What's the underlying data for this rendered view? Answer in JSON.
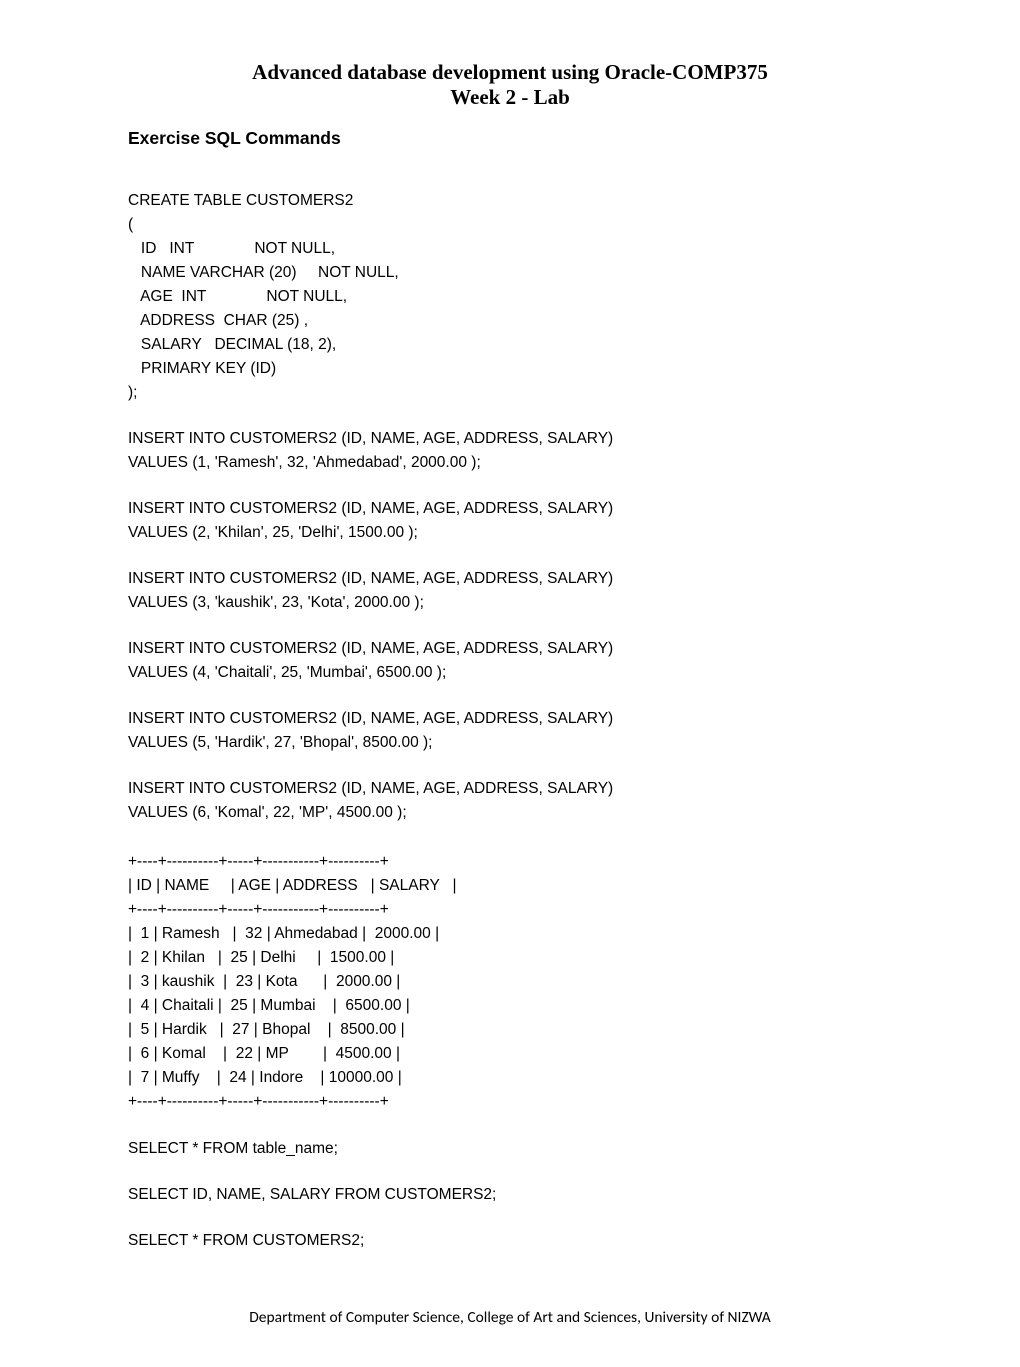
{
  "header": {
    "title": "Advanced database development using Oracle-COMP375",
    "subtitle": "Week 2 - Lab"
  },
  "section_title": "Exercise  SQL Commands",
  "create_table": "CREATE TABLE CUSTOMERS2\n(\n   ID   INT              NOT NULL,\n   NAME VARCHAR (20)     NOT NULL,\n   AGE  INT              NOT NULL,\n   ADDRESS  CHAR (25) ,\n   SALARY   DECIMAL (18, 2),       \n   PRIMARY KEY (ID)\n);",
  "inserts": [
    "INSERT INTO CUSTOMERS2 (ID, NAME, AGE, ADDRESS, SALARY)\nVALUES (1, 'Ramesh', 32, 'Ahmedabad', 2000.00 );",
    "INSERT INTO CUSTOMERS2 (ID, NAME, AGE, ADDRESS, SALARY)\nVALUES (2, 'Khilan', 25, 'Delhi', 1500.00 );",
    "INSERT INTO CUSTOMERS2 (ID, NAME, AGE, ADDRESS, SALARY)\nVALUES (3, 'kaushik', 23, 'Kota', 2000.00 );",
    "INSERT INTO CUSTOMERS2 (ID, NAME, AGE, ADDRESS, SALARY)\nVALUES (4, 'Chaitali', 25, 'Mumbai', 6500.00 );",
    "INSERT INTO CUSTOMERS2 (ID, NAME, AGE, ADDRESS, SALARY)\nVALUES (5, 'Hardik', 27, 'Bhopal', 8500.00 );",
    "INSERT INTO CUSTOMERS2 (ID, NAME, AGE, ADDRESS, SALARY)\nVALUES (6, 'Komal', 22, 'MP', 4500.00 );"
  ],
  "table_output": "+----+----------+-----+-----------+----------+\n| ID | NAME     | AGE | ADDRESS   | SALARY   |\n+----+----------+-----+-----------+----------+\n|  1 | Ramesh   |  32 | Ahmedabad |  2000.00 |\n|  2 | Khilan   |  25 | Delhi     |  1500.00 |\n|  3 | kaushik  |  23 | Kota      |  2000.00 |\n|  4 | Chaitali |  25 | Mumbai    |  6500.00 |\n|  5 | Hardik   |  27 | Bhopal    |  8500.00 |\n|  6 | Komal    |  22 | MP        |  4500.00 |\n|  7 | Muffy    |  24 | Indore    | 10000.00 |\n+----+----------+-----+-----------+----------+",
  "selects": [
    "SELECT * FROM table_name;",
    "SELECT ID, NAME, SALARY FROM CUSTOMERS2;",
    "SELECT * FROM CUSTOMERS2;"
  ],
  "footer": "Department of Computer Science, College of Art and Sciences, University of NIZWA"
}
